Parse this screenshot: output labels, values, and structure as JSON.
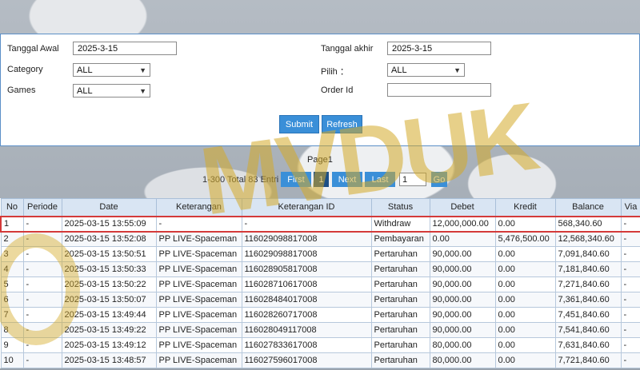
{
  "watermark": "MVDUK",
  "filters": {
    "tanggal_awal_label": "Tanggal Awal",
    "tanggal_awal_value": "2025-3-15",
    "tanggal_akhir_label": "Tanggal akhir",
    "tanggal_akhir_value": "2025-3-15",
    "category_label": "Category",
    "category_value": "ALL",
    "pilih_label": "Pilih ：",
    "pilih_value": "ALL",
    "games_label": "Games",
    "games_value": "ALL",
    "order_id_label": "Order Id",
    "order_id_value": "",
    "submit_label": "Submit",
    "refresh_label": "Refresh"
  },
  "pager": {
    "title": "Page1",
    "info": "1-300 Total 83 Entri",
    "first": "First",
    "current": "1",
    "next": "Next",
    "last": "Last",
    "page_value": "1",
    "go": "Go"
  },
  "table": {
    "columns": [
      "No",
      "Periode",
      "Date",
      "Keterangan",
      "Keterangan ID",
      "Status",
      "Debet",
      "Kredit",
      "Balance",
      "Via"
    ],
    "rows": [
      [
        "1",
        "-",
        "2025-03-15 13:55:09",
        "-",
        "-",
        "Withdraw",
        "12,000,000.00",
        "0.00",
        "568,340.60",
        "-"
      ],
      [
        "2",
        "-",
        "2025-03-15 13:52:08",
        "PP LIVE-Spaceman",
        "116029098817008",
        "Pembayaran",
        "0.00",
        "5,476,500.00",
        "12,568,340.60",
        "-"
      ],
      [
        "3",
        "-",
        "2025-03-15 13:50:51",
        "PP LIVE-Spaceman",
        "116029098817008",
        "Pertaruhan",
        "90,000.00",
        "0.00",
        "7,091,840.60",
        "-"
      ],
      [
        "4",
        "-",
        "2025-03-15 13:50:33",
        "PP LIVE-Spaceman",
        "116028905817008",
        "Pertaruhan",
        "90,000.00",
        "0.00",
        "7,181,840.60",
        "-"
      ],
      [
        "5",
        "-",
        "2025-03-15 13:50:22",
        "PP LIVE-Spaceman",
        "116028710617008",
        "Pertaruhan",
        "90,000.00",
        "0.00",
        "7,271,840.60",
        "-"
      ],
      [
        "6",
        "-",
        "2025-03-15 13:50:07",
        "PP LIVE-Spaceman",
        "116028484017008",
        "Pertaruhan",
        "90,000.00",
        "0.00",
        "7,361,840.60",
        "-"
      ],
      [
        "7",
        "-",
        "2025-03-15 13:49:44",
        "PP LIVE-Spaceman",
        "116028260717008",
        "Pertaruhan",
        "90,000.00",
        "0.00",
        "7,451,840.60",
        "-"
      ],
      [
        "8",
        "-",
        "2025-03-15 13:49:22",
        "PP LIVE-Spaceman",
        "116028049117008",
        "Pertaruhan",
        "90,000.00",
        "0.00",
        "7,541,840.60",
        "-"
      ],
      [
        "9",
        "-",
        "2025-03-15 13:49:12",
        "PP LIVE-Spaceman",
        "116027833617008",
        "Pertaruhan",
        "80,000.00",
        "0.00",
        "7,631,840.60",
        "-"
      ],
      [
        "10",
        "-",
        "2025-03-15 13:48:57",
        "PP LIVE-Spaceman",
        "116027596017008",
        "Pertaruhan",
        "80,000.00",
        "0.00",
        "7,721,840.60",
        "-"
      ]
    ]
  },
  "colors": {
    "accent": "#3a8fd8",
    "highlight_border": "#d43a3a",
    "negative_text": "#e0201a",
    "link": "#3a7fc4"
  }
}
